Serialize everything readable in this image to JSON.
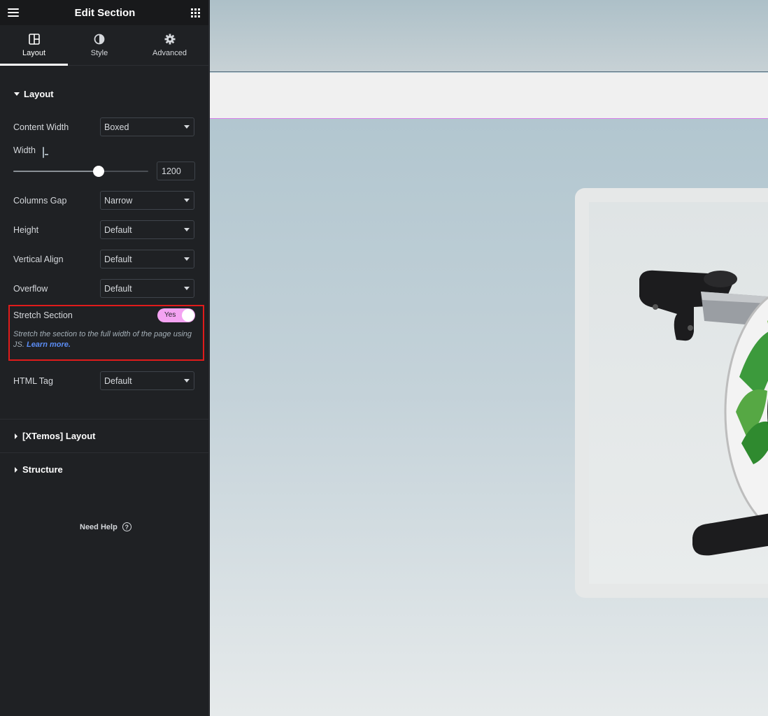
{
  "header": {
    "title": "Edit Section"
  },
  "tabs": [
    {
      "label": "Layout",
      "active": true
    },
    {
      "label": "Style",
      "active": false
    },
    {
      "label": "Advanced",
      "active": false
    }
  ],
  "layout_section": {
    "title": "Layout",
    "content_width": {
      "label": "Content Width",
      "value": "Boxed"
    },
    "width": {
      "label": "Width",
      "value": "1200",
      "slider_fraction": 0.63
    },
    "columns_gap": {
      "label": "Columns Gap",
      "value": "Narrow"
    },
    "height": {
      "label": "Height",
      "value": "Default"
    },
    "vertical_align": {
      "label": "Vertical Align",
      "value": "Default"
    },
    "overflow": {
      "label": "Overflow",
      "value": "Default"
    },
    "stretch": {
      "label": "Stretch Section",
      "toggle_label": "Yes",
      "description": "Stretch the section to the full width of the page using JS.",
      "learn_more": "Learn more."
    },
    "html_tag": {
      "label": "HTML Tag",
      "value": "Default"
    }
  },
  "collapsed_sections": {
    "xtemos": "[XTemos] Layout",
    "structure": "Structure"
  },
  "help": {
    "label": "Need Help",
    "icon": "?"
  },
  "colors": {
    "panel_bg": "#1f2124",
    "toggle_on": "#f4a3f2",
    "highlight_border": "#e01b1b",
    "link": "#5b8df5"
  }
}
